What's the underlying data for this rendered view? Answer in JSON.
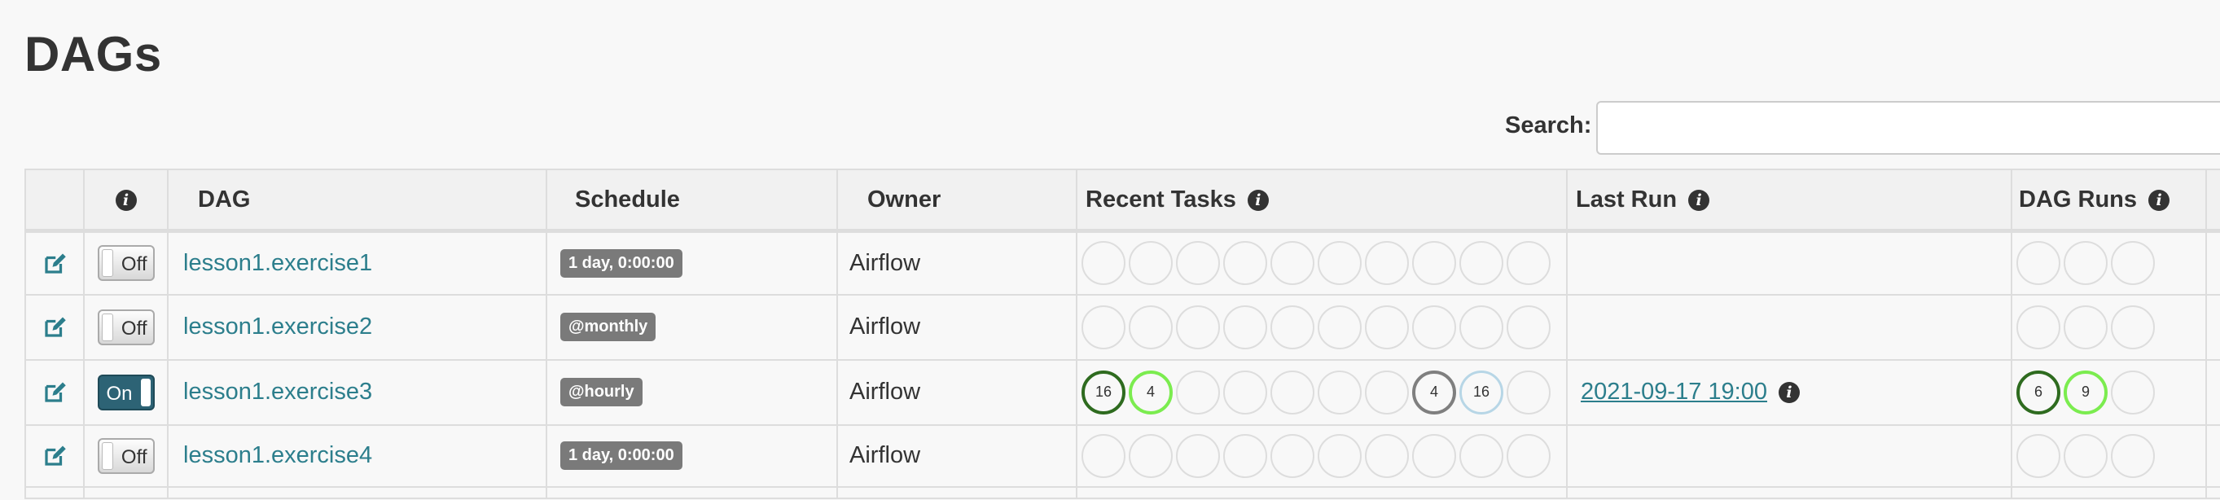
{
  "page": {
    "title": "DAGs"
  },
  "search": {
    "label": "Search:",
    "value": ""
  },
  "table": {
    "headers": {
      "dag": "DAG",
      "schedule": "Schedule",
      "owner": "Owner",
      "recent_tasks": "Recent Tasks",
      "last_run": "Last Run",
      "dag_runs": "DAG Runs"
    },
    "rows": [
      {
        "toggle": "Off",
        "dag_id": "lesson1.exercise1",
        "schedule": "1 day, 0:00:00",
        "owner": "Airflow",
        "last_run": "",
        "recent_tasks": [
          {
            "count": "",
            "state": "none"
          },
          {
            "count": "",
            "state": "none"
          },
          {
            "count": "",
            "state": "none"
          },
          {
            "count": "",
            "state": "none"
          },
          {
            "count": "",
            "state": "none"
          },
          {
            "count": "",
            "state": "none"
          },
          {
            "count": "",
            "state": "none"
          },
          {
            "count": "",
            "state": "none"
          },
          {
            "count": "",
            "state": "none"
          },
          {
            "count": "",
            "state": "none"
          }
        ],
        "dag_runs": [
          {
            "count": "",
            "state": "none"
          },
          {
            "count": "",
            "state": "none"
          },
          {
            "count": "",
            "state": "none"
          }
        ]
      },
      {
        "toggle": "Off",
        "dag_id": "lesson1.exercise2",
        "schedule": "@monthly",
        "owner": "Airflow",
        "last_run": "",
        "recent_tasks": [
          {
            "count": "",
            "state": "none"
          },
          {
            "count": "",
            "state": "none"
          },
          {
            "count": "",
            "state": "none"
          },
          {
            "count": "",
            "state": "none"
          },
          {
            "count": "",
            "state": "none"
          },
          {
            "count": "",
            "state": "none"
          },
          {
            "count": "",
            "state": "none"
          },
          {
            "count": "",
            "state": "none"
          },
          {
            "count": "",
            "state": "none"
          },
          {
            "count": "",
            "state": "none"
          }
        ],
        "dag_runs": [
          {
            "count": "",
            "state": "none"
          },
          {
            "count": "",
            "state": "none"
          },
          {
            "count": "",
            "state": "none"
          }
        ]
      },
      {
        "toggle": "On",
        "dag_id": "lesson1.exercise3",
        "schedule": "@hourly",
        "owner": "Airflow",
        "last_run": "2021-09-17 19:00",
        "recent_tasks": [
          {
            "count": "16",
            "state": "success"
          },
          {
            "count": "4",
            "state": "running"
          },
          {
            "count": "",
            "state": "none"
          },
          {
            "count": "",
            "state": "none"
          },
          {
            "count": "",
            "state": "none"
          },
          {
            "count": "",
            "state": "none"
          },
          {
            "count": "",
            "state": "none"
          },
          {
            "count": "4",
            "state": "removed"
          },
          {
            "count": "16",
            "state": "scheduled"
          },
          {
            "count": "",
            "state": "none"
          }
        ],
        "dag_runs": [
          {
            "count": "6",
            "state": "success"
          },
          {
            "count": "9",
            "state": "running"
          },
          {
            "count": "",
            "state": "none"
          }
        ]
      },
      {
        "toggle": "Off",
        "dag_id": "lesson1.exercise4",
        "schedule": "1 day, 0:00:00",
        "owner": "Airflow",
        "last_run": "",
        "recent_tasks": [
          {
            "count": "",
            "state": "none"
          },
          {
            "count": "",
            "state": "none"
          },
          {
            "count": "",
            "state": "none"
          },
          {
            "count": "",
            "state": "none"
          },
          {
            "count": "",
            "state": "none"
          },
          {
            "count": "",
            "state": "none"
          },
          {
            "count": "",
            "state": "none"
          },
          {
            "count": "",
            "state": "none"
          },
          {
            "count": "",
            "state": "none"
          },
          {
            "count": "",
            "state": "none"
          }
        ],
        "dag_runs": [
          {
            "count": "",
            "state": "none"
          },
          {
            "count": "",
            "state": "none"
          },
          {
            "count": "",
            "state": "none"
          }
        ]
      }
    ]
  },
  "colors": {
    "link": "#2c7e8c",
    "toggle_on": "#2d6375",
    "success": "#2e6b1f",
    "running": "#7bec4f",
    "removed": "#7f7f7f",
    "scheduled": "#b7d6e6",
    "schedule_badge": "#7a7a7a"
  },
  "icons": {
    "edit": "edit-icon",
    "info": "info-icon"
  }
}
